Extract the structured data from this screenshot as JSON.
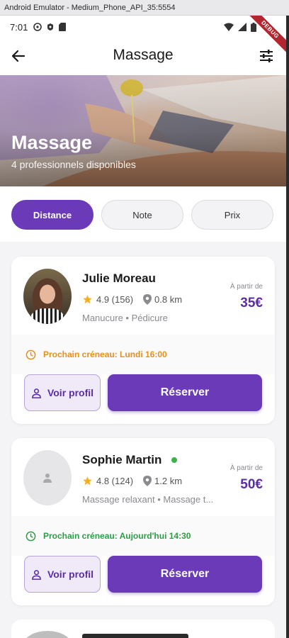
{
  "emulator": {
    "title": "Android Emulator - Medium_Phone_API_35:5554"
  },
  "status_bar": {
    "time": "7:01"
  },
  "debug_banner": {
    "label": "DEBUG"
  },
  "app_bar": {
    "title": "Massage"
  },
  "hero": {
    "title": "Massage",
    "subtitle": "4 professionnels disponibles"
  },
  "sort": {
    "options": [
      "Distance",
      "Note",
      "Prix"
    ],
    "selected": "Distance"
  },
  "colors": {
    "primary": "#6a3ab8",
    "accent_text": "#5b2ea6",
    "slot_orange": "#e3901f",
    "slot_green": "#2e9c46",
    "online": "#3cb44b",
    "star": "#f2b01e"
  },
  "professionals": [
    {
      "name": "Julie Moreau",
      "rating": "4.9 (156)",
      "distance": "0.8 km",
      "services": "Manucure • Pédicure",
      "price_label": "À partir de",
      "price": "35€",
      "next_slot": "Prochain créneau: Lundi 16:00",
      "profile_button": "Voir profil",
      "reserve_button": "Réserver",
      "online": false
    },
    {
      "name": "Sophie Martin",
      "rating": "4.8 (124)",
      "distance": "1.2 km",
      "services": "Massage relaxant • Massage t...",
      "price_label": "À partir de",
      "price": "50€",
      "next_slot": "Prochain créneau: Aujourd'hui 14:30",
      "profile_button": "Voir profil",
      "reserve_button": "Réserver",
      "online": true
    }
  ]
}
